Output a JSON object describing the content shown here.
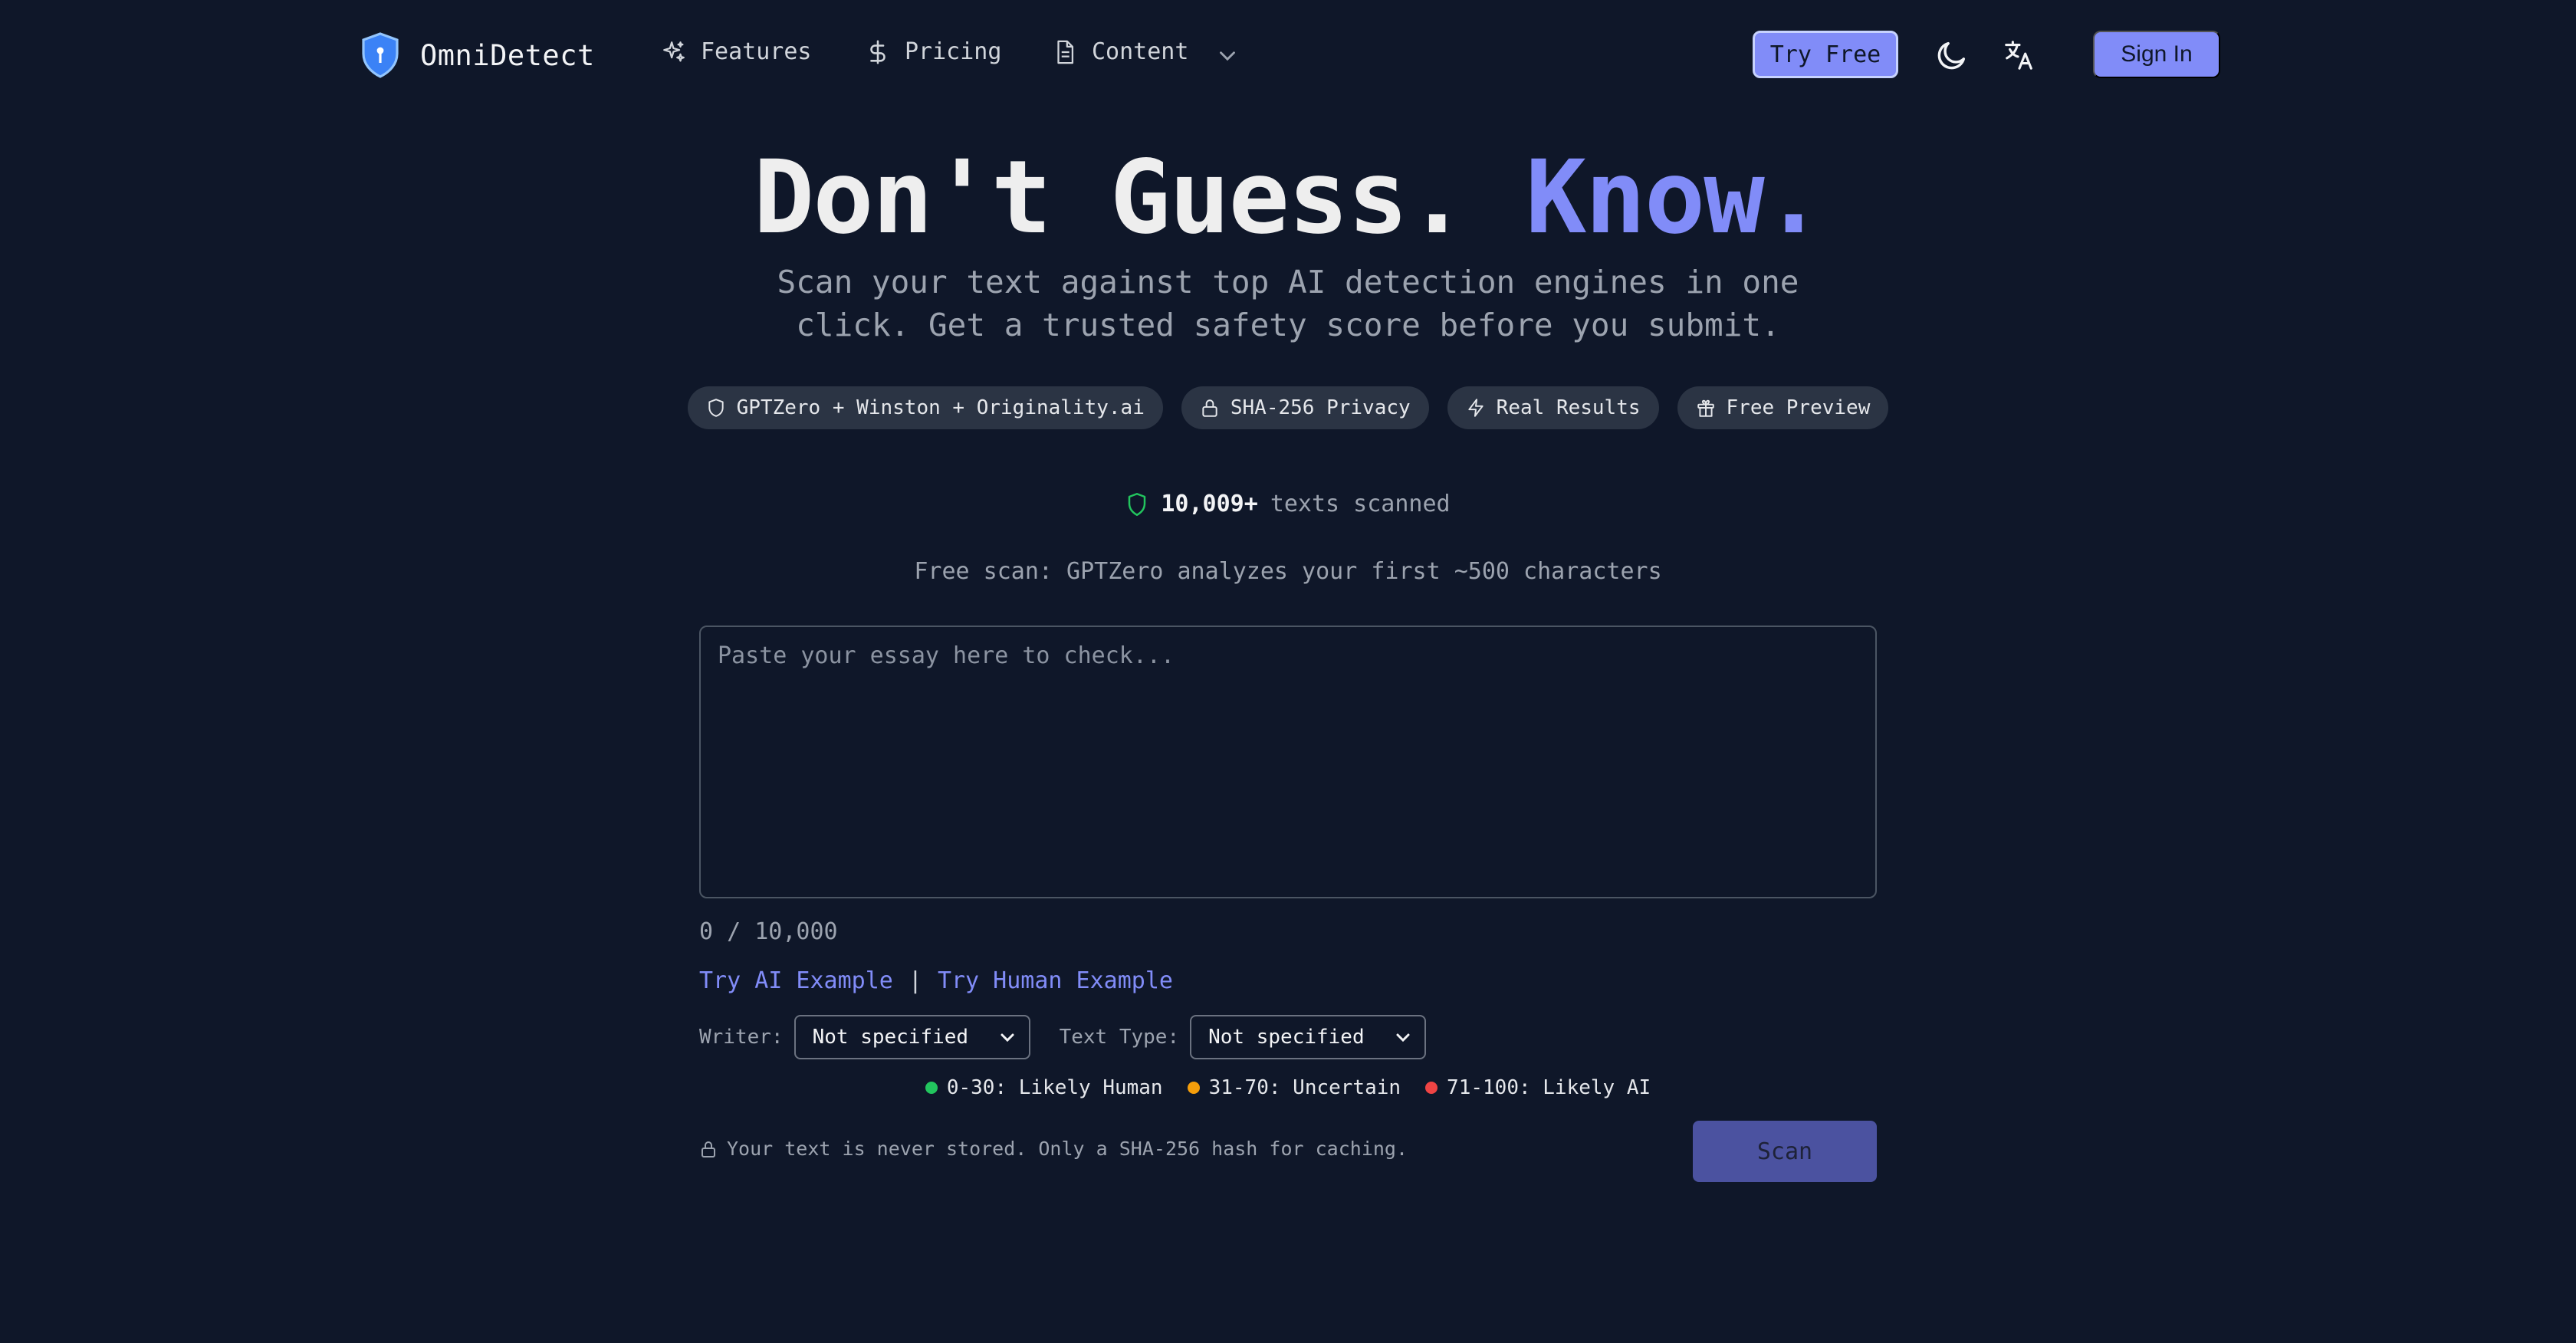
{
  "colors": {
    "background": "#0f1729",
    "accent": "#818cf8",
    "chip_bg": "#2b3444",
    "muted_text": "#9ca3af",
    "green": "#22c55e",
    "amber": "#f59e0b",
    "red": "#ef4444",
    "scan_button": "#4b52a0"
  },
  "nav": {
    "brand": "OmniDetect",
    "brand_icon": "shield-icon",
    "links": [
      {
        "label": "Features",
        "icon": "sparkles-icon"
      },
      {
        "label": "Pricing",
        "icon": "dollar-icon"
      },
      {
        "label": "Content",
        "icon": "document-icon",
        "has_dropdown": true
      }
    ],
    "try_free": "Try Free",
    "theme_icon": "moon-icon",
    "language_icon": "translate-icon",
    "sign_in": "Sign In"
  },
  "hero": {
    "title_part1": "Don't Guess.",
    "title_part2": "Know.",
    "subtitle": "Scan your text against top AI detection engines in one click. Get a trusted safety score before you submit."
  },
  "chips": [
    {
      "label": "GPTZero + Winston + Originality.ai",
      "icon": "shield-icon"
    },
    {
      "label": "SHA-256 Privacy",
      "icon": "lock-icon"
    },
    {
      "label": "Real Results",
      "icon": "lightning-icon"
    },
    {
      "label": "Free Preview",
      "icon": "gift-icon"
    }
  ],
  "stats": {
    "count": "10,009+",
    "label": "texts scanned"
  },
  "free_scan_note": "Free scan: GPTZero analyzes your first ~500 characters",
  "editor": {
    "placeholder": "Paste your essay here to check...",
    "value": "",
    "char_count": "0 / 10,000"
  },
  "examples": {
    "ai": "Try AI Example",
    "separator": "|",
    "human": "Try Human Example"
  },
  "selects": {
    "writer_label": "Writer:",
    "writer_value": "Not specified",
    "text_type_label": "Text Type:",
    "text_type_value": "Not specified"
  },
  "legend": [
    {
      "label": "0-30: Likely Human",
      "color": "#22c55e"
    },
    {
      "label": "31-70: Uncertain",
      "color": "#f59e0b"
    },
    {
      "label": "71-100: Likely AI",
      "color": "#ef4444"
    }
  ],
  "privacy_note": "Your text is never stored. Only a SHA-256 hash for caching.",
  "scan_button": "Scan"
}
